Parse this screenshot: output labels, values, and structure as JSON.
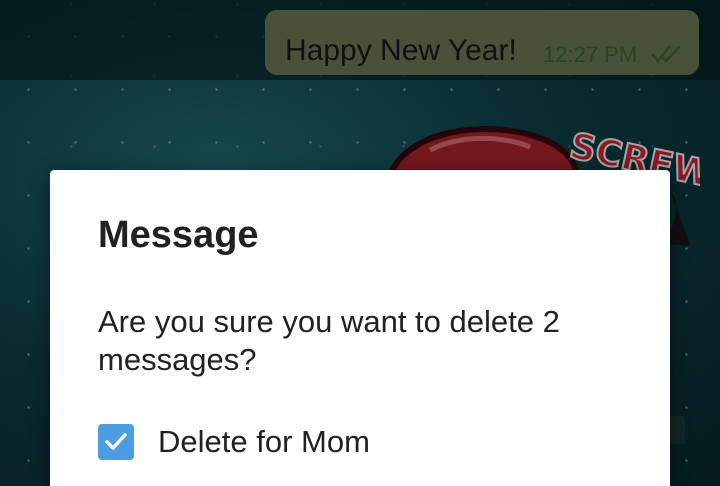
{
  "chat": {
    "message": {
      "text": "Happy New Year!",
      "time": "12:27 PM",
      "status_icon": "double-check-icon"
    },
    "sticker": {
      "text": "SCREW"
    }
  },
  "dialog": {
    "title": "Message",
    "body": "Are you sure you want to delete 2 messages?",
    "checkbox": {
      "label": "Delete for Mom",
      "checked": true
    }
  },
  "colors": {
    "bubble": "#6f7d5a",
    "time_text": "#3f6a2c",
    "checkbox_accent": "#4a9de0",
    "dialog_bg": "#ffffff"
  }
}
